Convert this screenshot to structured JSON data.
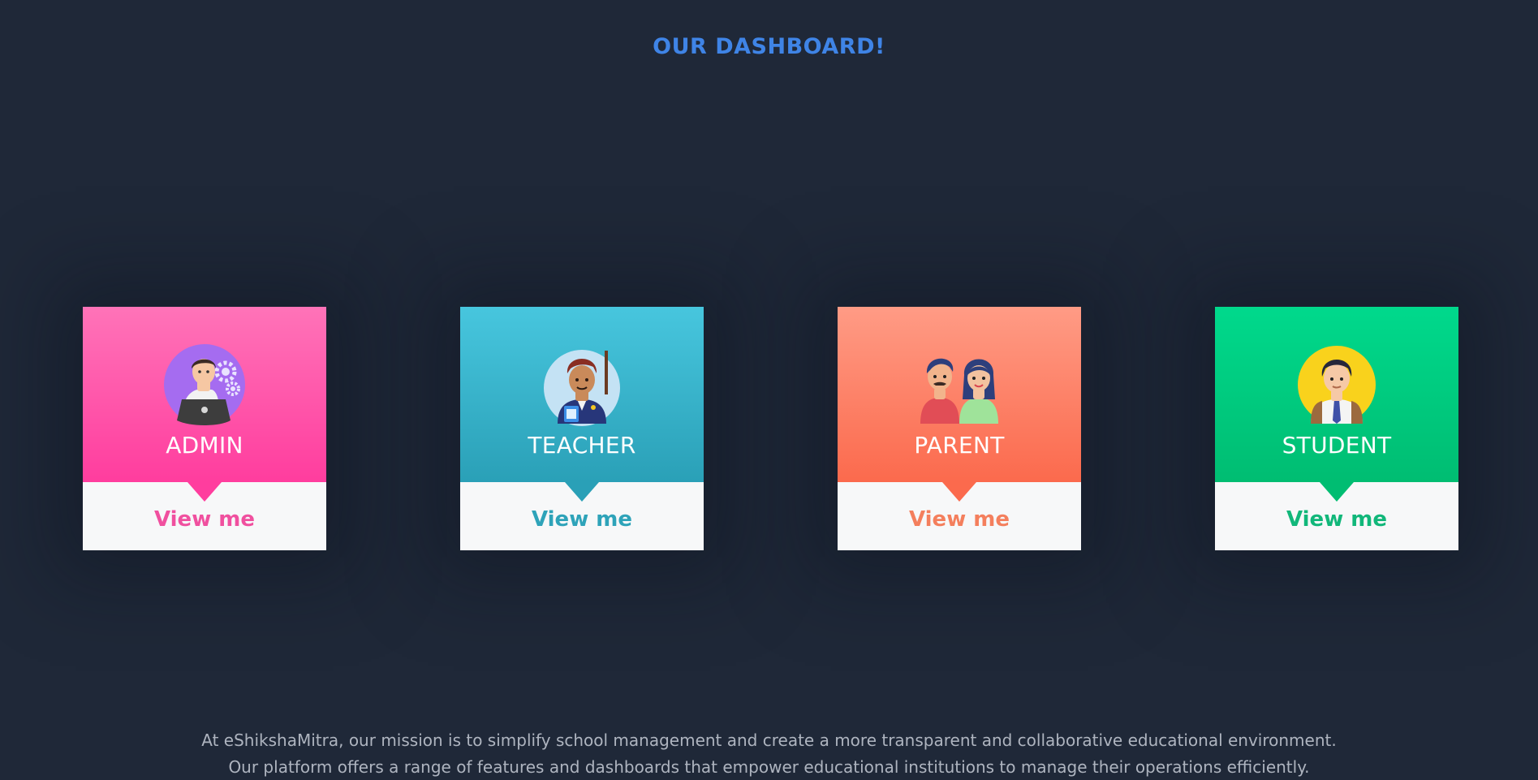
{
  "page": {
    "heading": "OUR DASHBOARD!"
  },
  "cards": [
    {
      "role": "ADMIN",
      "cta": "View me",
      "icon": "admin-avatar-icon",
      "accent": "#ff3d9e"
    },
    {
      "role": "TEACHER",
      "cta": "View me",
      "icon": "teacher-avatar-icon",
      "accent": "#2aa0b7"
    },
    {
      "role": "PARENT",
      "cta": "View me",
      "icon": "parent-avatar-icon",
      "accent": "#fb6a4d"
    },
    {
      "role": "STUDENT",
      "cta": "View me",
      "icon": "student-avatar-icon",
      "accent": "#00bd72"
    }
  ],
  "footer": {
    "line1": "At eShikshaMitra, our mission is to simplify school management and create a more transparent and collaborative educational environment.",
    "line2": "Our platform offers a range of features and dashboards that empower educational institutions to manage their operations efficiently."
  },
  "colors": {
    "background": "#1f2838",
    "heading": "#3f84e6"
  }
}
